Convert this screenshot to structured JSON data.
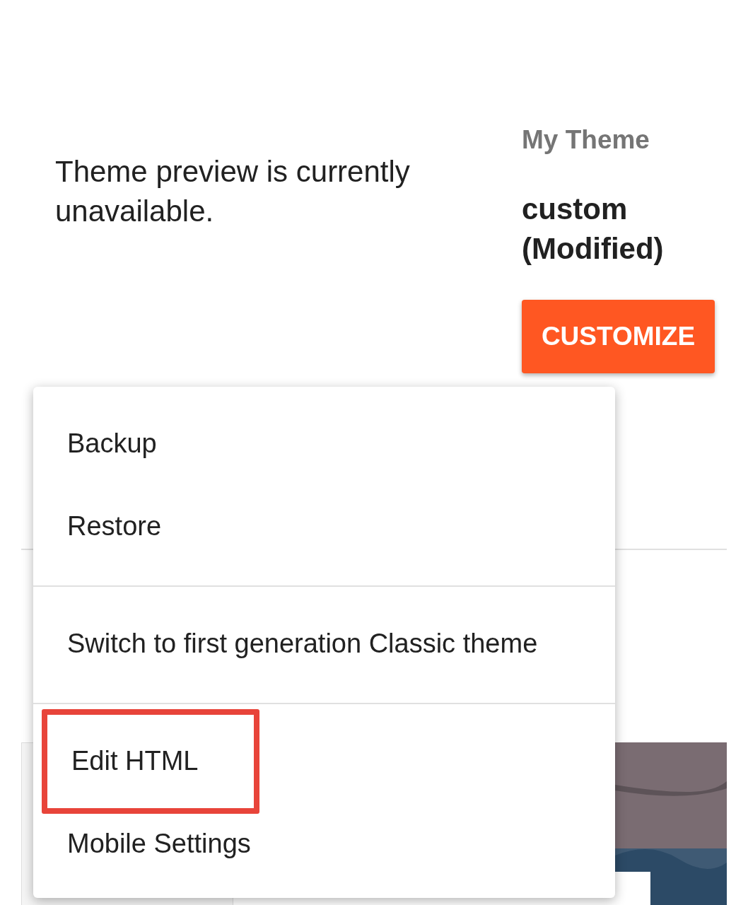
{
  "preview_message": "Theme preview is currently unavailable.",
  "theme": {
    "label": "My Theme",
    "name": "custom (Modified)",
    "button": "CUSTOMIZE"
  },
  "menu": {
    "items": [
      {
        "label": "Backup",
        "highlighted": false,
        "divider_after": false
      },
      {
        "label": "Restore",
        "highlighted": false,
        "divider_after": true
      },
      {
        "label": "Switch to first generation Classic theme",
        "highlighted": false,
        "divider_after": true
      },
      {
        "label": "Edit HTML",
        "highlighted": true,
        "divider_after": false
      },
      {
        "label": "Mobile Settings",
        "highlighted": false,
        "divider_after": false
      }
    ]
  }
}
